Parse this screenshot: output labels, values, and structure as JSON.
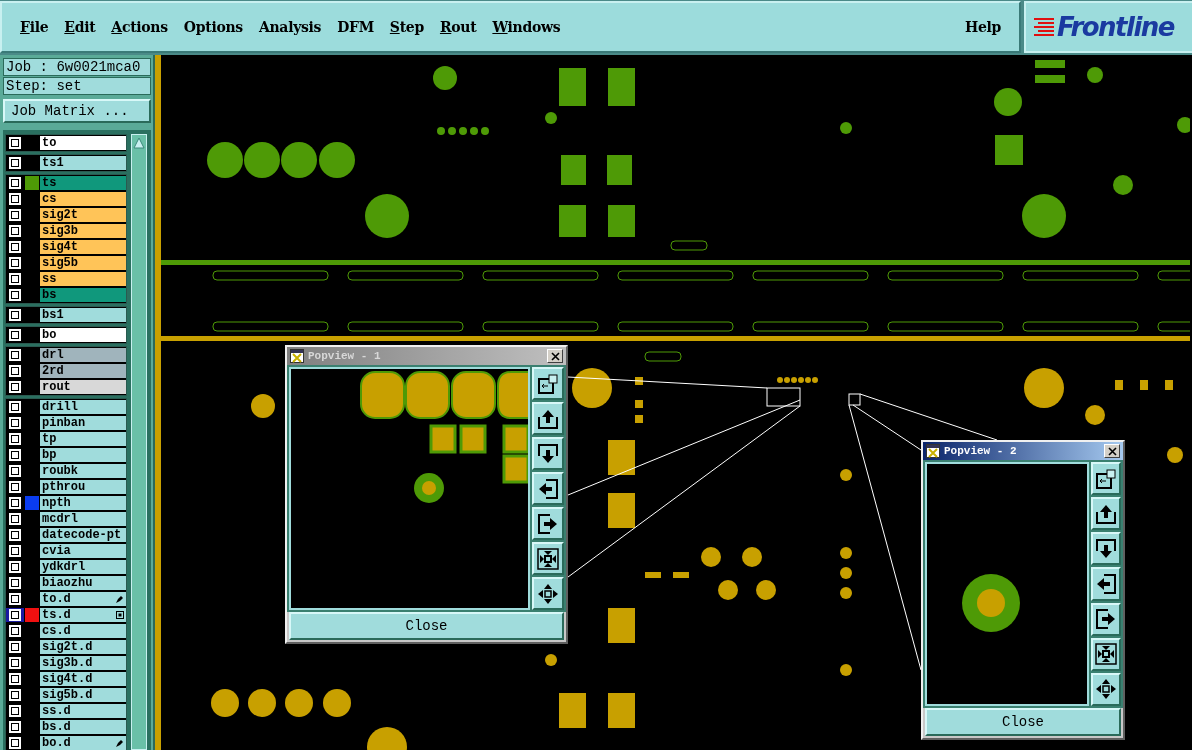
{
  "menu": [
    {
      "label": "File",
      "underlined": true
    },
    {
      "label": "Edit",
      "underlined": true
    },
    {
      "label": "Actions",
      "underlined": true
    },
    {
      "label": "Options",
      "underlined": false
    },
    {
      "label": "Analysis",
      "underlined": false
    },
    {
      "label": "DFM",
      "underlined": false
    },
    {
      "label": "Step",
      "underlined": true
    },
    {
      "label": "Rout",
      "underlined": true
    },
    {
      "label": "Windows",
      "underlined": true
    }
  ],
  "help": "Help",
  "logo": "Frontline",
  "job": "Job : 6w0021mca0",
  "step": "Step: set",
  "matrix_button": "Job Matrix ...",
  "layer_groups": [
    {
      "layers": [
        {
          "name": "to",
          "kind": "board",
          "selected": false
        }
      ]
    },
    {
      "layers": [
        {
          "name": "ts1",
          "kind": "misc",
          "selected": false
        }
      ]
    },
    {
      "layers": [
        {
          "name": "ts",
          "kind": "mask",
          "selected": false,
          "color": "#4e9a06"
        },
        {
          "name": "cs",
          "kind": "signal",
          "selected": false
        },
        {
          "name": "sig2t",
          "kind": "signal",
          "selected": false
        },
        {
          "name": "sig3b",
          "kind": "signal",
          "selected": false
        },
        {
          "name": "sig4t",
          "kind": "signal",
          "selected": false
        },
        {
          "name": "sig5b",
          "kind": "signal",
          "selected": false
        },
        {
          "name": "ss",
          "kind": "signal",
          "selected": false
        },
        {
          "name": "bs",
          "kind": "mask",
          "selected": false
        }
      ]
    },
    {
      "layers": [
        {
          "name": "bs1",
          "kind": "misc",
          "selected": false
        }
      ]
    },
    {
      "layers": [
        {
          "name": "bo",
          "kind": "board",
          "selected": false
        }
      ]
    },
    {
      "layers": [
        {
          "name": "drl",
          "kind": "drill",
          "selected": false
        },
        {
          "name": "2rd",
          "kind": "drill",
          "selected": false
        },
        {
          "name": "rout",
          "kind": "rout",
          "selected": false
        }
      ]
    },
    {
      "layers": [
        {
          "name": "drill",
          "kind": "misc",
          "selected": false
        },
        {
          "name": "pinban",
          "kind": "misc",
          "selected": false
        },
        {
          "name": "tp",
          "kind": "misc",
          "selected": false
        },
        {
          "name": "bp",
          "kind": "misc",
          "selected": false
        },
        {
          "name": "roubk",
          "kind": "misc",
          "selected": false
        },
        {
          "name": "pthrou",
          "kind": "misc",
          "selected": false
        },
        {
          "name": "npth",
          "kind": "misc",
          "selected": false,
          "color": "#0a3cf0"
        },
        {
          "name": "mcdrl",
          "kind": "misc",
          "selected": false
        },
        {
          "name": "datecode-pt",
          "kind": "misc",
          "selected": false
        },
        {
          "name": "cvia",
          "kind": "misc",
          "selected": false
        },
        {
          "name": "ydkdrl",
          "kind": "misc",
          "selected": false
        },
        {
          "name": "biaozhu",
          "kind": "misc",
          "selected": false
        },
        {
          "name": "to.d",
          "kind": "misc",
          "selected": false,
          "hand": true
        },
        {
          "name": "ts.d",
          "kind": "misc",
          "selected": true,
          "color": "#f01010",
          "grid": true
        },
        {
          "name": "cs.d",
          "kind": "misc",
          "selected": false
        },
        {
          "name": "sig2t.d",
          "kind": "misc",
          "selected": false
        },
        {
          "name": "sig3b.d",
          "kind": "misc",
          "selected": false
        },
        {
          "name": "sig4t.d",
          "kind": "misc",
          "selected": false
        },
        {
          "name": "sig5b.d",
          "kind": "misc",
          "selected": false
        },
        {
          "name": "ss.d",
          "kind": "misc",
          "selected": false
        },
        {
          "name": "bs.d",
          "kind": "misc",
          "selected": false
        },
        {
          "name": "bo.d",
          "kind": "misc",
          "selected": false,
          "hand": true
        }
      ]
    }
  ],
  "popviews": [
    {
      "title": "Popview - 1",
      "active": false,
      "kind": "pads",
      "close": "Close"
    },
    {
      "title": "Popview - 2",
      "active": true,
      "kind": "via",
      "close": "Close"
    }
  ]
}
